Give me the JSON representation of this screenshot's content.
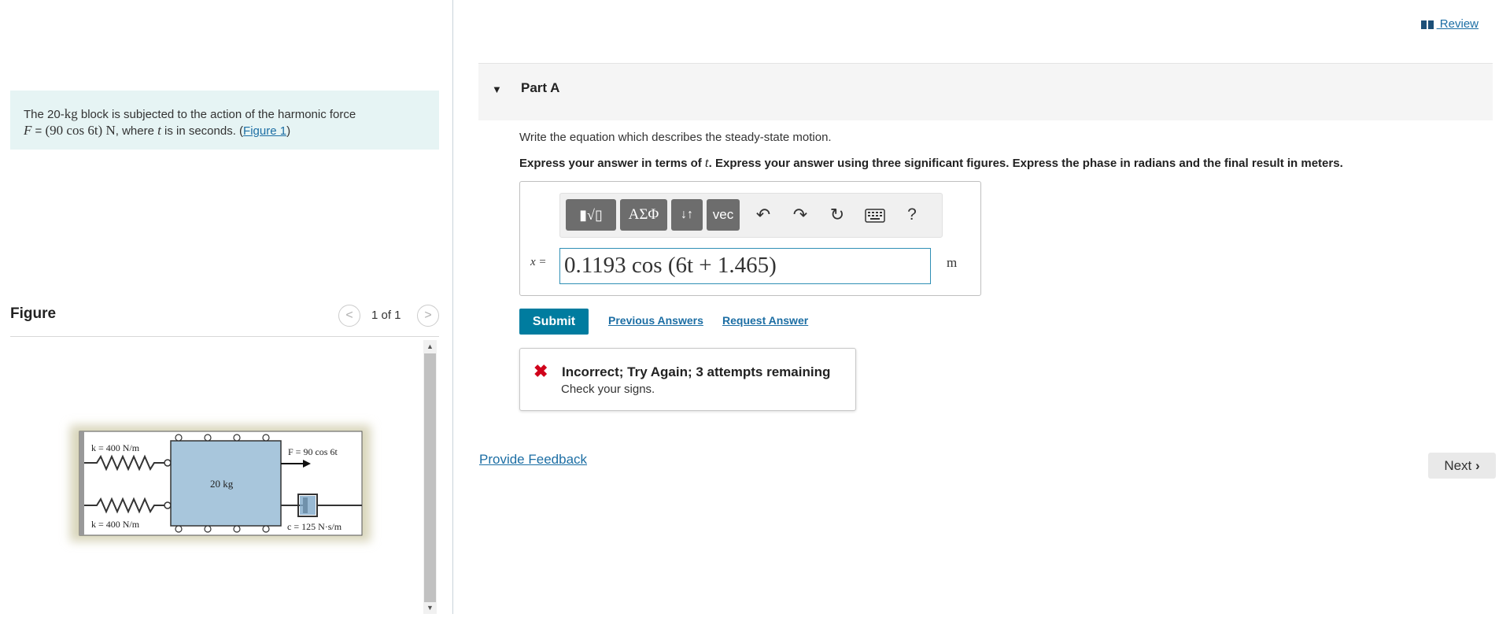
{
  "problem": {
    "text_before": "The 20-",
    "mass_unit": "kg",
    "text_mid1": " block is subjected to the action of the harmonic force",
    "force_symbol": "F",
    "text_mid2": " = ",
    "force_expr": "(90 cos 6t) N",
    "text_mid3": ", where ",
    "time_symbol": "t",
    "text_mid4": " is in seconds. (",
    "figure_link": "Figure 1",
    "text_end": ")"
  },
  "figure": {
    "title": "Figure",
    "count": "1 of 1",
    "prev_icon": "chevron-left-icon",
    "next_icon": "chevron-right-icon",
    "labels": {
      "k_top": "k = 400 N/m",
      "k_bottom": "k = 400 N/m",
      "force": "F = 90 cos 6t",
      "mass": "20 kg",
      "damping": "c = 125 N·s/m"
    }
  },
  "header": {
    "review_label": " Review",
    "review_icon": "book-icon"
  },
  "part": {
    "title": "Part A",
    "instruction": "Write the equation which describes the steady-state motion.",
    "instruction_bold_pre": "Express your answer in terms of ",
    "instruction_bold_var": "t",
    "instruction_bold_post": ". Express your answer using three significant figures. Express the phase in radians and the final result in meters."
  },
  "toolbar": {
    "templates_label": "▮√▯",
    "greek_label": "ΑΣΦ",
    "arrows_label": "↓↑",
    "vec_label": "vec",
    "help_label": "?"
  },
  "answer": {
    "label": "x =",
    "value": "0.1193 cos (6t + 1.465)",
    "unit": "m"
  },
  "actions": {
    "submit_label": "Submit",
    "previous_label": "Previous Answers",
    "request_label": "Request Answer"
  },
  "feedback": {
    "title": "Incorrect; Try Again; 3 attempts remaining",
    "message": "Check your signs.",
    "icon": "x-icon",
    "icon_color": "#d0021b"
  },
  "footer": {
    "provide_feedback": "Provide Feedback",
    "next_label": "Next"
  },
  "colors": {
    "accent": "#007c9f",
    "link": "#1c6ea4",
    "problem_bg": "#e6f4f4"
  }
}
